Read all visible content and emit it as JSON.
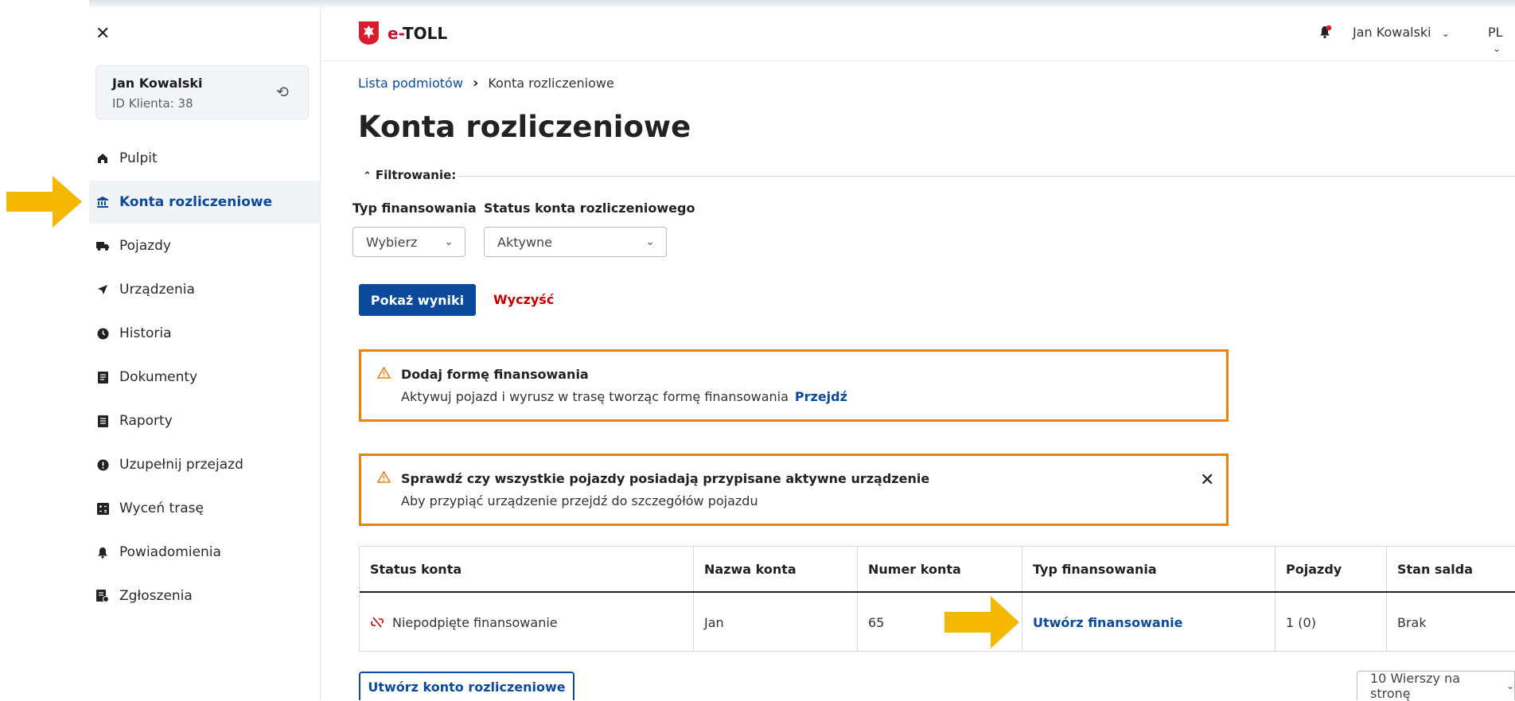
{
  "sidebar": {
    "close_icon": "close-icon",
    "client": {
      "name": "Jan Kowalski",
      "id_label": "ID Klienta: 38"
    },
    "items": [
      {
        "label": "Pulpit",
        "icon": "home-icon"
      },
      {
        "label": "Konta rozliczeniowe",
        "icon": "bank-icon",
        "active": true
      },
      {
        "label": "Pojazdy",
        "icon": "truck-icon"
      },
      {
        "label": "Urządzenia",
        "icon": "navigation-arrow-icon"
      },
      {
        "label": "Historia",
        "icon": "clock-icon"
      },
      {
        "label": "Dokumenty",
        "icon": "document-icon"
      },
      {
        "label": "Raporty",
        "icon": "report-icon"
      },
      {
        "label": "Uzupełnij przejazd",
        "icon": "alert-circle-icon"
      },
      {
        "label": "Wyceń trasę",
        "icon": "calculator-icon"
      },
      {
        "label": "Powiadomienia",
        "icon": "bell-icon"
      },
      {
        "label": "Zgłoszenia",
        "icon": "ticket-icon"
      }
    ]
  },
  "header": {
    "logo_e": "e-",
    "logo_toll": "TOLL",
    "user": "Jan Kowalski",
    "lang": "PL"
  },
  "breadcrumb": {
    "first": "Lista podmiotów",
    "current": "Konta rozliczeniowe"
  },
  "page_title": "Konta rozliczeniowe",
  "filter": {
    "toggle_label": "Filtrowanie:",
    "financing_label": "Typ finansowania",
    "financing_value": "Wybierz",
    "status_label": "Status konta rozliczeniowego",
    "status_value": "Aktywne",
    "show_results": "Pokaż wyniki",
    "clear": "Wyczyść"
  },
  "alerts": [
    {
      "title": "Dodaj formę finansowania",
      "text": "Aktywuj pojazd i wyrusz w trasę tworząc formę finansowania",
      "link": "Przejdź"
    },
    {
      "title": "Sprawdź czy wszystkie pojazdy posiadają przypisane aktywne urządzenie",
      "text": "Aby przypiąć urządzenie przejdź do szczegółów pojazdu"
    }
  ],
  "table": {
    "headers": [
      "Status konta",
      "Nazwa konta",
      "Numer konta",
      "Typ finansowania",
      "Pojazdy",
      "Stan salda"
    ],
    "row": {
      "status": "Niepodpięte finansowanie",
      "name": "Jan",
      "number": "65",
      "financing_link": "Utwórz finansowanie",
      "vehicles": "1 (0)",
      "balance": "Brak"
    }
  },
  "footer": {
    "create_account": "Utwórz konto rozliczeniowe",
    "rows_per_page": "10 Wierszy na stronę"
  },
  "colors": {
    "primary": "#0b4a9a",
    "alert_border": "#e8820c",
    "danger": "#c00000",
    "annotation_arrow": "#f5b800"
  }
}
